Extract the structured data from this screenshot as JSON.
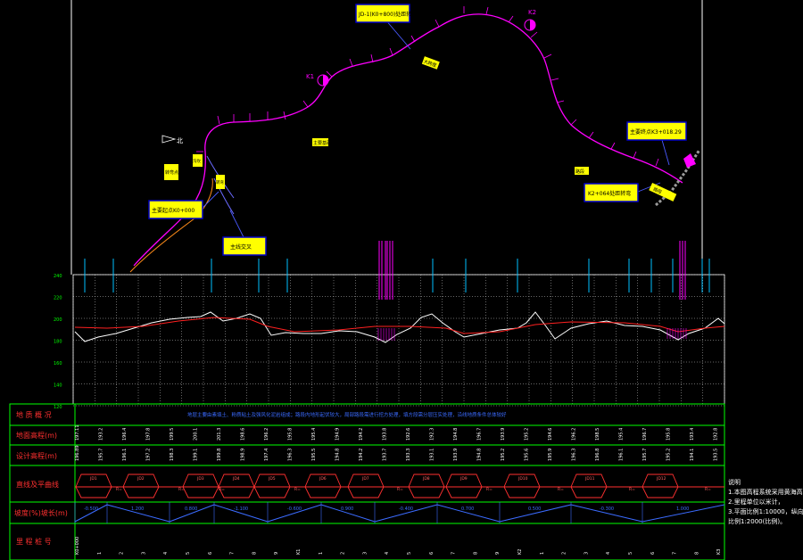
{
  "colors": {
    "background": "#000000",
    "route": "#ff00ff",
    "ground": "#ffffff",
    "design": "#ff2020",
    "grid": "#00ff00",
    "label_fill": "#ffff00",
    "label_border": "#0000cc",
    "slope_line": "#3b6bff",
    "annotation": "#ff00ff"
  },
  "plan": {
    "labels": [
      {
        "text": "JD-1(K0+800)处距转弯",
        "kind": "box"
      },
      {
        "text": "大跨度",
        "kind": "tag"
      },
      {
        "text": "主要基础",
        "kind": "tag"
      },
      {
        "text": "转弯点",
        "kind": "tag"
      },
      {
        "text": "沟坎",
        "kind": "tag"
      },
      {
        "text": "主要起点K0+000",
        "kind": "box"
      },
      {
        "text": "主线交叉",
        "kind": "box"
      },
      {
        "text": "主要终点K3+018.29",
        "kind": "box"
      },
      {
        "text": "K2+064处距转弯",
        "kind": "box"
      },
      {
        "text": "转弯",
        "kind": "tag"
      },
      {
        "text": "路段",
        "kind": "tag"
      },
      {
        "text": "路段",
        "kind": "tag"
      }
    ],
    "markers": [
      "K1",
      "K2",
      "北"
    ]
  },
  "profile": {
    "y_ticks": [
      "240",
      "220",
      "200",
      "180",
      "160",
      "140",
      "120"
    ]
  },
  "band": {
    "row_labels": [
      "地 质 概 况",
      "地面高程(m)",
      "设计高程(m)",
      "直线及平曲线",
      "坡度(%)坡长(m)",
      "里 程 桩 号"
    ],
    "geology_text": "地层主要由素填土、粉质粘土及强风化泥岩组成；路段内地形起伏较大，局部路段需进行挖方处理，填方段需分层压实处理，沿线地质条件总体较好",
    "ground_values": [
      "197.11",
      "193.2",
      "196.4",
      "197.8",
      "199.5",
      "200.1",
      "201.3",
      "198.6",
      "196.2",
      "195.8",
      "195.4",
      "194.9",
      "194.2",
      "193.8",
      "192.6",
      "192.3",
      "194.8",
      "196.7",
      "193.9",
      "195.2",
      "194.6",
      "196.2",
      "198.5",
      "195.4",
      "196.7",
      "195.8",
      "193.4",
      "192.8"
    ],
    "design_values": [
      "196.89",
      "195.7",
      "196.1",
      "197.2",
      "198.3",
      "199.1",
      "199.8",
      "198.9",
      "197.4",
      "196.3",
      "195.5",
      "194.8",
      "194.2",
      "193.7",
      "193.3",
      "193.1",
      "193.9",
      "194.8",
      "195.2",
      "195.6",
      "195.9",
      "196.3",
      "196.8",
      "196.1",
      "195.7",
      "195.2",
      "194.1",
      "193.5"
    ],
    "curves": [
      "JD1",
      "JD2",
      "JD3",
      "JD4",
      "JD5",
      "JD6",
      "JD7",
      "JD8",
      "JD9",
      "JD10",
      "JD11",
      "JD12"
    ],
    "curve_notes": [
      "R=",
      "R=",
      "R=",
      "R=",
      "R=",
      "R=",
      "R=",
      "R=",
      "R="
    ],
    "slopes": [
      "-0.500",
      "1.200",
      "0.800",
      "-1.100",
      "-0.600",
      "0.900",
      "-0.400",
      "0.700",
      "0.500",
      "-0.300",
      "1.000"
    ],
    "chainage": [
      "K0+000",
      "1",
      "2",
      "3",
      "4",
      "5",
      "6",
      "7",
      "8",
      "9",
      "K1",
      "1",
      "2",
      "3",
      "4",
      "5",
      "6",
      "7",
      "8",
      "9",
      "K2",
      "1",
      "2",
      "3",
      "4",
      "5",
      "6",
      "7",
      "8",
      "K3"
    ]
  },
  "notes": {
    "title": "说明",
    "lines": [
      "1.本图高程系统采用黄海高程。",
      "2.里程单位以米计，",
      "3.平面比例1:10000，纵向",
      "比例1:2000(比例)。"
    ]
  }
}
